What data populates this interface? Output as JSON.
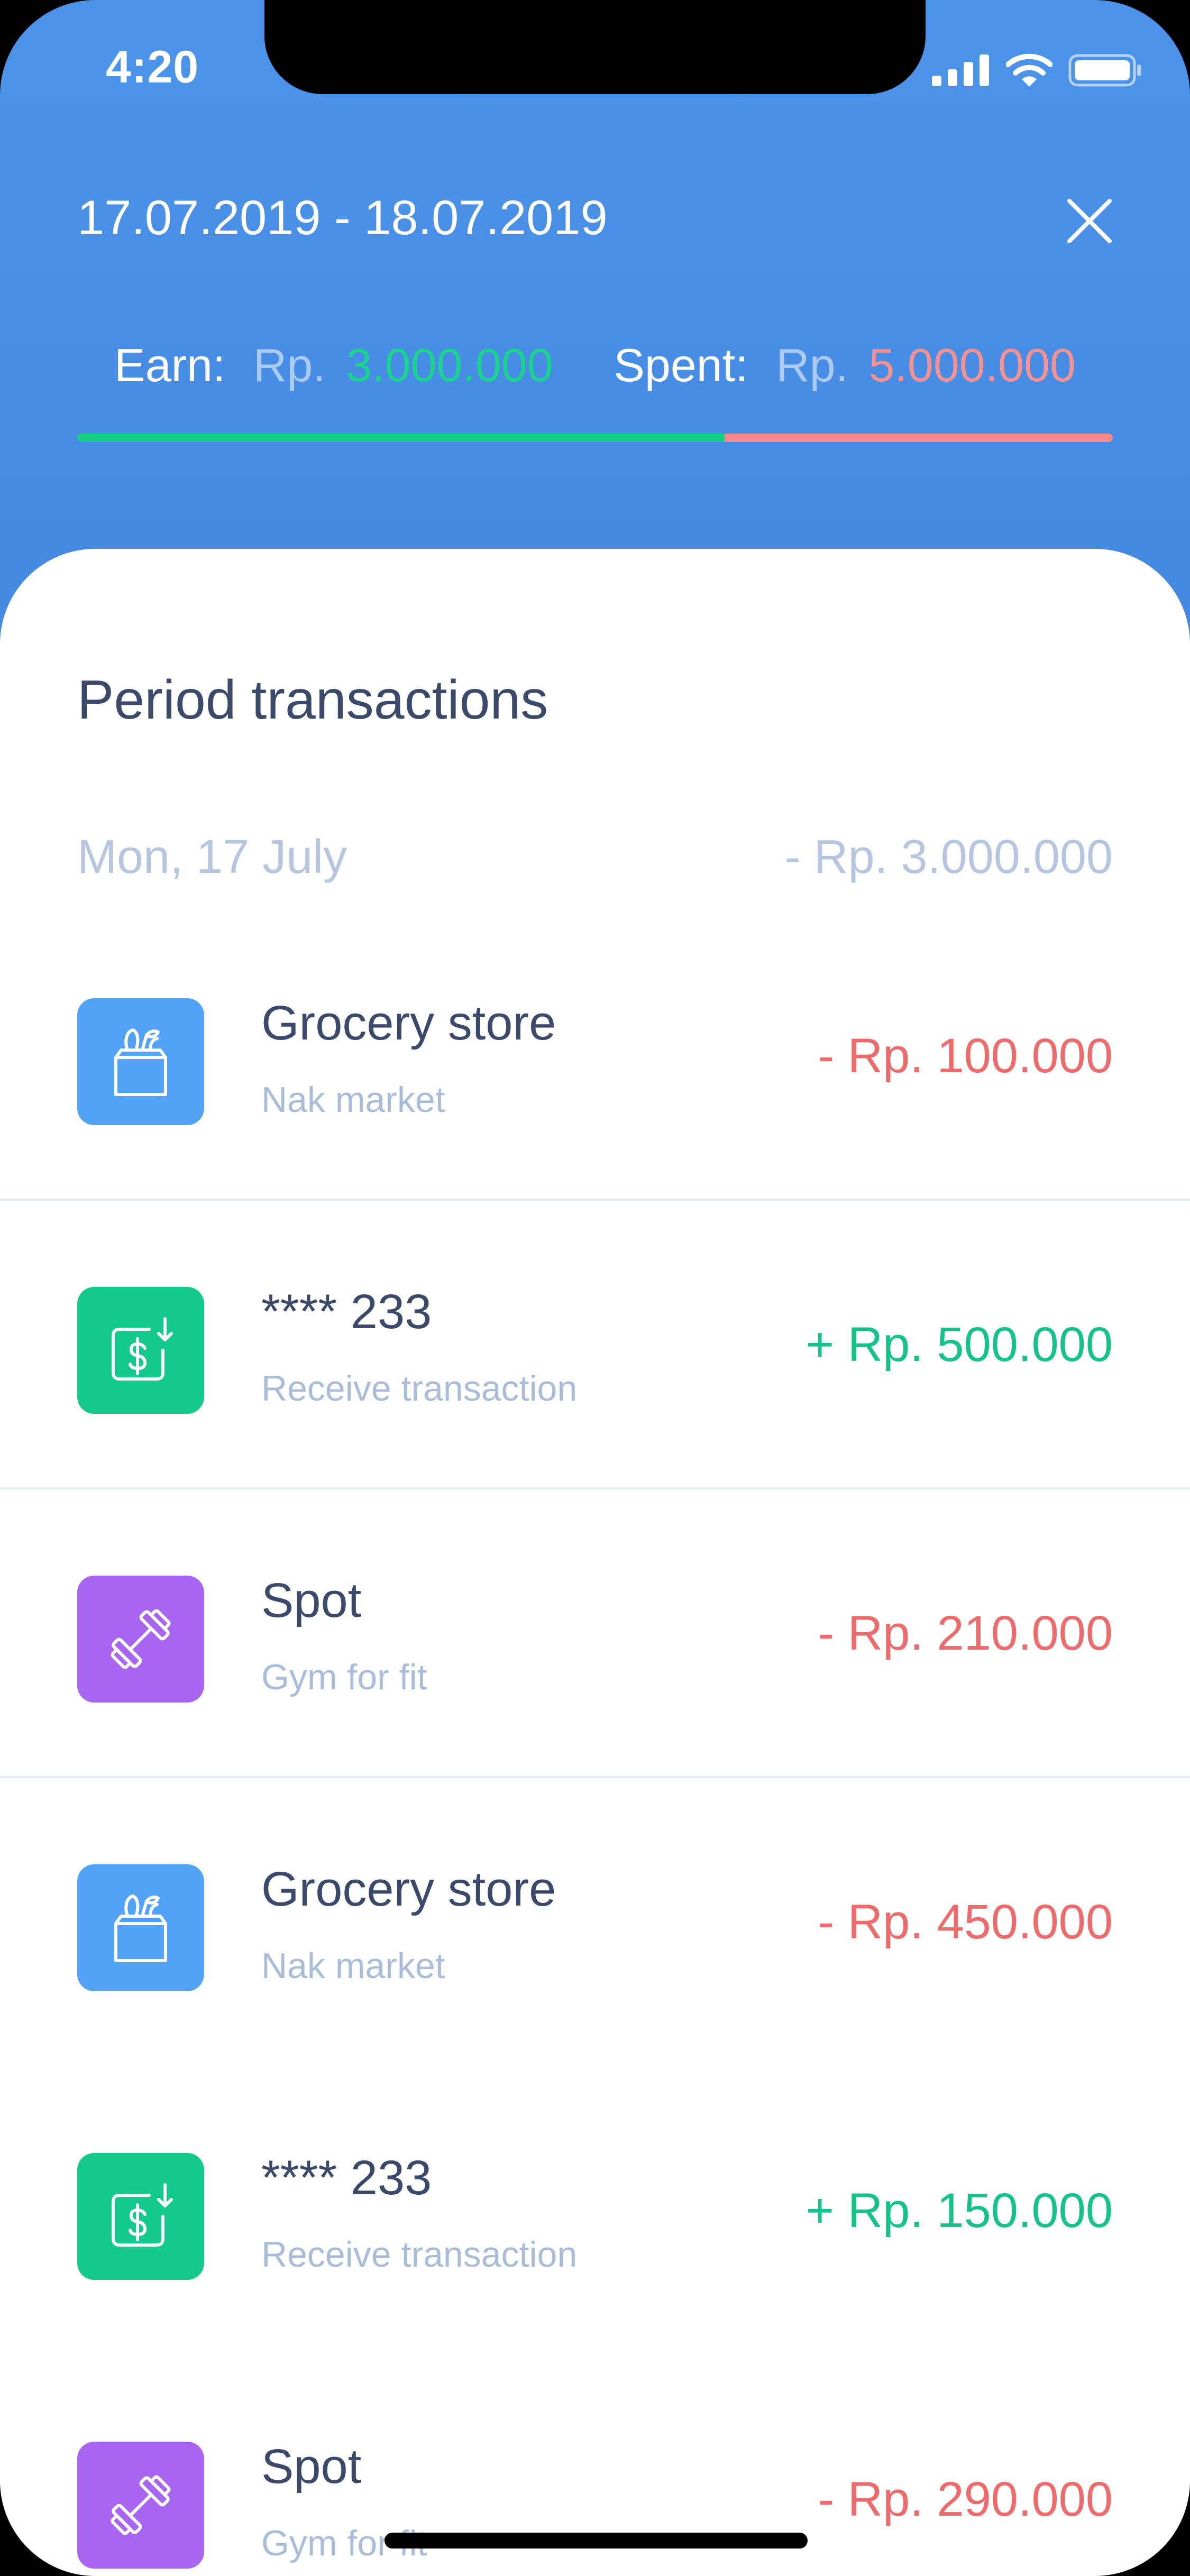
{
  "status_bar": {
    "time": "4:20"
  },
  "header": {
    "date_range": "17.07.2019 - 18.07.2019",
    "earn_label": "Earn:",
    "earn_currency": "Rp.",
    "earn_value": "3.000.000",
    "spent_label": "Spent:",
    "spent_currency": "Rp.",
    "spent_value": "5.000.000",
    "earn_share_fraction": 0.625
  },
  "main": {
    "section_title": "Period transactions",
    "day_label": "Mon, 17 July",
    "day_total": "- Rp. 3.000.000",
    "transactions": [
      {
        "name": "Grocery store",
        "subtitle": "Nak market",
        "amount": "- Rp. 100.000",
        "type": "expense",
        "icon": "grocery-bag-icon",
        "color": "#52a2f8"
      },
      {
        "name": "**** 233",
        "subtitle": "Receive transaction",
        "amount": "+ Rp. 500.000",
        "type": "income",
        "icon": "receive-money-icon",
        "color": "#14c98c"
      },
      {
        "name": "Spot",
        "subtitle": "Gym for fit",
        "amount": "- Rp. 210.000",
        "type": "expense",
        "icon": "dumbbell-icon",
        "color": "#a866f0"
      },
      {
        "name": "Grocery store",
        "subtitle": "Nak market",
        "amount": "- Rp. 450.000",
        "type": "expense",
        "icon": "grocery-bag-icon",
        "color": "#52a2f8"
      },
      {
        "name": "**** 233",
        "subtitle": "Receive transaction",
        "amount": "+ Rp. 150.000",
        "type": "income",
        "icon": "receive-money-icon",
        "color": "#14c98c"
      },
      {
        "name": "Spot",
        "subtitle": "Gym for fit",
        "amount": "- Rp. 290.000",
        "type": "expense",
        "icon": "dumbbell-icon",
        "color": "#a866f0"
      }
    ]
  },
  "colors": {
    "header_gradient_top": "#4c93ea",
    "header_gradient_bottom": "#2f66b8",
    "income": "#14c38a",
    "expense": "#ef6b6b"
  }
}
